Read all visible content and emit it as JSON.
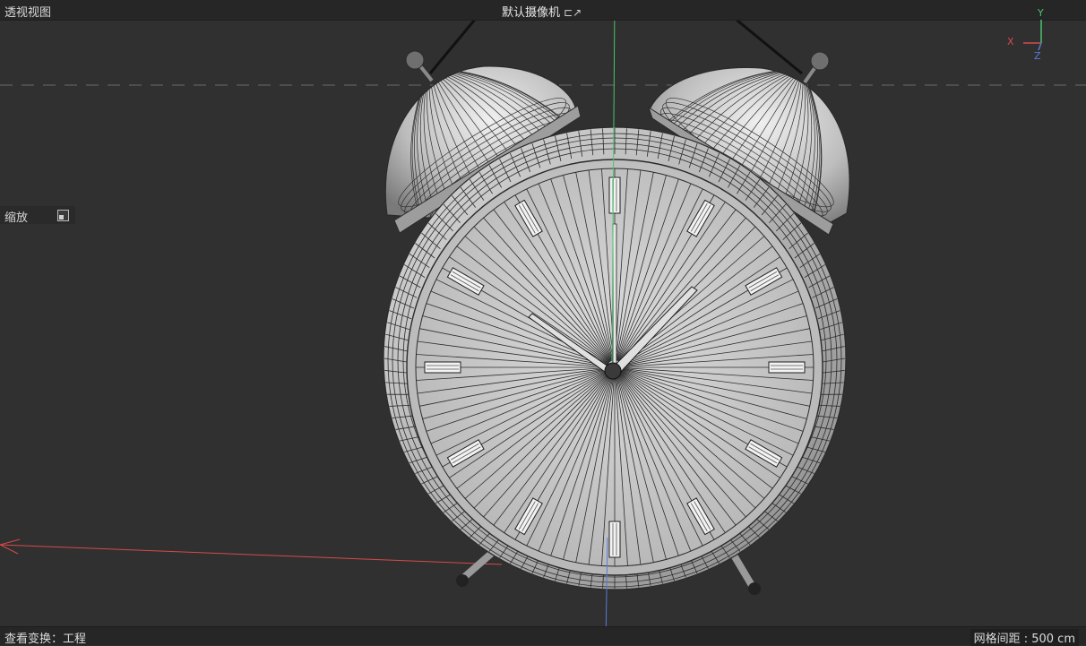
{
  "viewport": {
    "title": "透视视图",
    "camera": "默认摄像机",
    "camera_icon": "camera-target-icon",
    "zoom_label": "缩放",
    "zoom_icon": "zoom-frame-icon"
  },
  "status": {
    "view_transform": "查看变换：工程",
    "grid_spacing": "网格间距 : 500 cm"
  },
  "axes": {
    "y": "Y",
    "x": "X",
    "z": "Z"
  },
  "colors": {
    "background": "#303030",
    "axis_x": "#d64a4a",
    "axis_y": "#4ac46a",
    "axis_z": "#5a7ad8",
    "wire": "#2a2a2a",
    "surface": "#c8c8c8"
  }
}
